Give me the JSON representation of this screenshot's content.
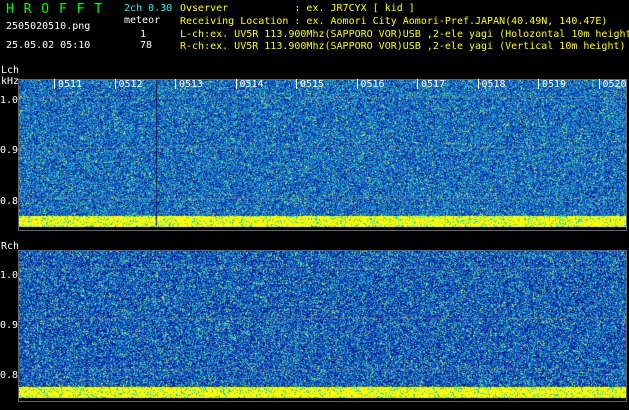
{
  "header": {
    "logo": "H R O F F T",
    "mode": "2ch 0.30",
    "meteor_label": "meteor",
    "filename": "2505020510.png",
    "datetime": "25.05.02 05:10",
    "lch_count": "1",
    "rch_count": "78"
  },
  "info": {
    "observer_line": "Ovserver           : ex. JR7CYX [ kid ]",
    "location_line": "Receiving Location : ex. Aomori City Aomori-Pref.JAPAN(40.49N, 140.47E)",
    "lch_line": "L-ch:ex. UV5R 113.900Mhz(SAPPORO VOR)USB ,2-ele yagi (Holozontal 10m height)",
    "rch_line": "R-ch:ex. UV5R 113.900Mhz(SAPPORO VOR)USB ,2-ele yagi (Vertical 10m height)"
  },
  "lch": {
    "label": "Lch",
    "unit": "kHz",
    "ticks": [
      "1.0",
      "0.9",
      "0.8"
    ]
  },
  "rch": {
    "label": "Rch",
    "ticks": [
      "1.0",
      "0.9",
      "0.8"
    ]
  },
  "time_ticks": [
    "0511",
    "0512",
    "0513",
    "0514",
    "0515",
    "0516",
    "0517",
    "0518",
    "0519",
    "0520"
  ],
  "colors": {
    "background": "#000000",
    "text_green": "#00ff00",
    "text_white": "#ffffff",
    "waterfall_low": "#0a2fa0",
    "waterfall_mid": "#1e90c8",
    "waterfall_high": "#ffff00"
  }
}
